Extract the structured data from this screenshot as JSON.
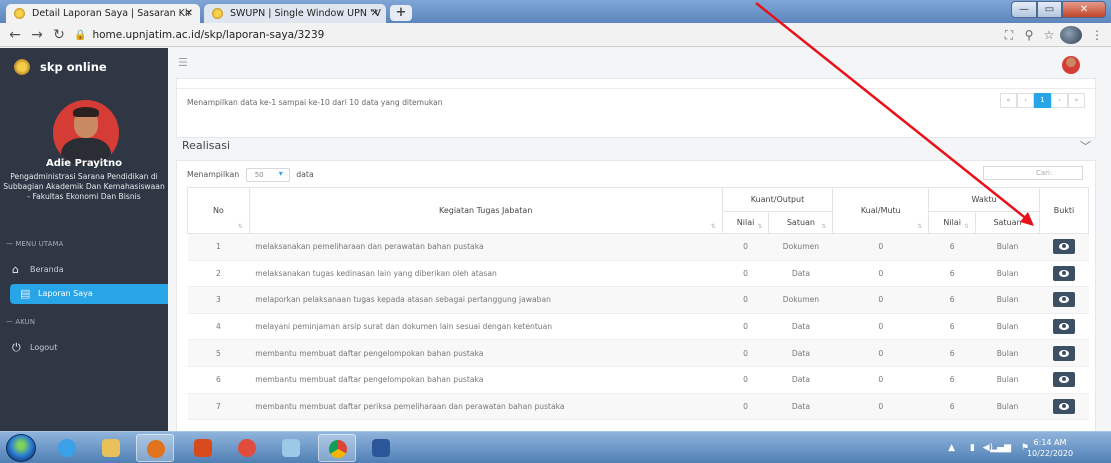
{
  "browser": {
    "tabs": [
      {
        "label": "Detail Laporan Saya | Sasaran Kir"
      },
      {
        "label": "SWUPN | Single Window UPN \"V"
      }
    ],
    "new_tab": "+",
    "url": "home.upnjatim.ac.id/skp/laporan-saya/3239"
  },
  "sidebar": {
    "brand": "skp online",
    "user_name": "Adie Prayitno",
    "user_job": "Pengadministrasi Sarana Pendidikan di Subbagian Akademik Dan Kemahasiswaan - Fakultas Ekonomi Dan Bisnis",
    "section_main": "— MENU UTAMA",
    "section_account": "— AKUN",
    "items": [
      {
        "label": "Beranda",
        "icon": "home-icon"
      },
      {
        "label": "Laporan Saya",
        "icon": "document-icon"
      },
      {
        "label": "Logout",
        "icon": "power-icon"
      }
    ]
  },
  "main": {
    "pagination_info": "Menampilkan data ke-1 sampai ke-10 dari 10 data yang ditemukan",
    "pager": [
      "«",
      "‹",
      "1",
      "›",
      "»"
    ],
    "section_title": "Realisasi",
    "length_prefix": "Menampilkan",
    "length_value": "50",
    "length_suffix": "data",
    "search_placeholder": "Cari:",
    "table": {
      "headers": {
        "no": "No",
        "kegiatan": "Kegiatan Tugas Jabatan",
        "kuant_output": "Kuant/Output",
        "nilai": "Nilai",
        "satuan": "Satuan",
        "kual_mutu": "Kual/Mutu",
        "waktu": "Waktu",
        "waktu_nilai": "Nilai",
        "waktu_satuan": "Satuan",
        "bukti": "Bukti"
      },
      "rows": [
        {
          "no": "1",
          "kegiatan": "melaksanakan pemeliharaan dan perawatan bahan pustaka",
          "nilai": "0",
          "satuan": "Dokumen",
          "mutu": "0",
          "waktu": "6",
          "wsatuan": "Bulan"
        },
        {
          "no": "2",
          "kegiatan": "melaksanakan tugas kedinasan lain yang diberikan oleh atasan",
          "nilai": "0",
          "satuan": "Data",
          "mutu": "0",
          "waktu": "6",
          "wsatuan": "Bulan"
        },
        {
          "no": "3",
          "kegiatan": "melaporkan pelaksanaan tugas kepada atasan sebagai pertanggung jawaban",
          "nilai": "0",
          "satuan": "Dokumen",
          "mutu": "0",
          "waktu": "6",
          "wsatuan": "Bulan"
        },
        {
          "no": "4",
          "kegiatan": "melayani peminjaman arsip surat dan dokumen lain sesuai dengan ketentuan",
          "nilai": "0",
          "satuan": "Data",
          "mutu": "0",
          "waktu": "6",
          "wsatuan": "Bulan"
        },
        {
          "no": "5",
          "kegiatan": "membantu membuat daftar pengelompokan bahan pustaka",
          "nilai": "0",
          "satuan": "Data",
          "mutu": "0",
          "waktu": "6",
          "wsatuan": "Bulan"
        },
        {
          "no": "6",
          "kegiatan": "membantu membuat daftar pengelompokan bahan pustaka",
          "nilai": "0",
          "satuan": "Data",
          "mutu": "0",
          "waktu": "6",
          "wsatuan": "Bulan"
        },
        {
          "no": "7",
          "kegiatan": "membantu membuat daftar periksa pemeliharaan dan perawatan bahan pustaka",
          "nilai": "0",
          "satuan": "Data",
          "mutu": "0",
          "waktu": "6",
          "wsatuan": "Bulan"
        }
      ]
    }
  },
  "taskbar": {
    "time": "6:14 AM",
    "date": "10/22/2020"
  },
  "colors": {
    "sidebar_bg": "#2f3744",
    "accent": "#28a5e7",
    "annotation_arrow": "#e8101a"
  }
}
